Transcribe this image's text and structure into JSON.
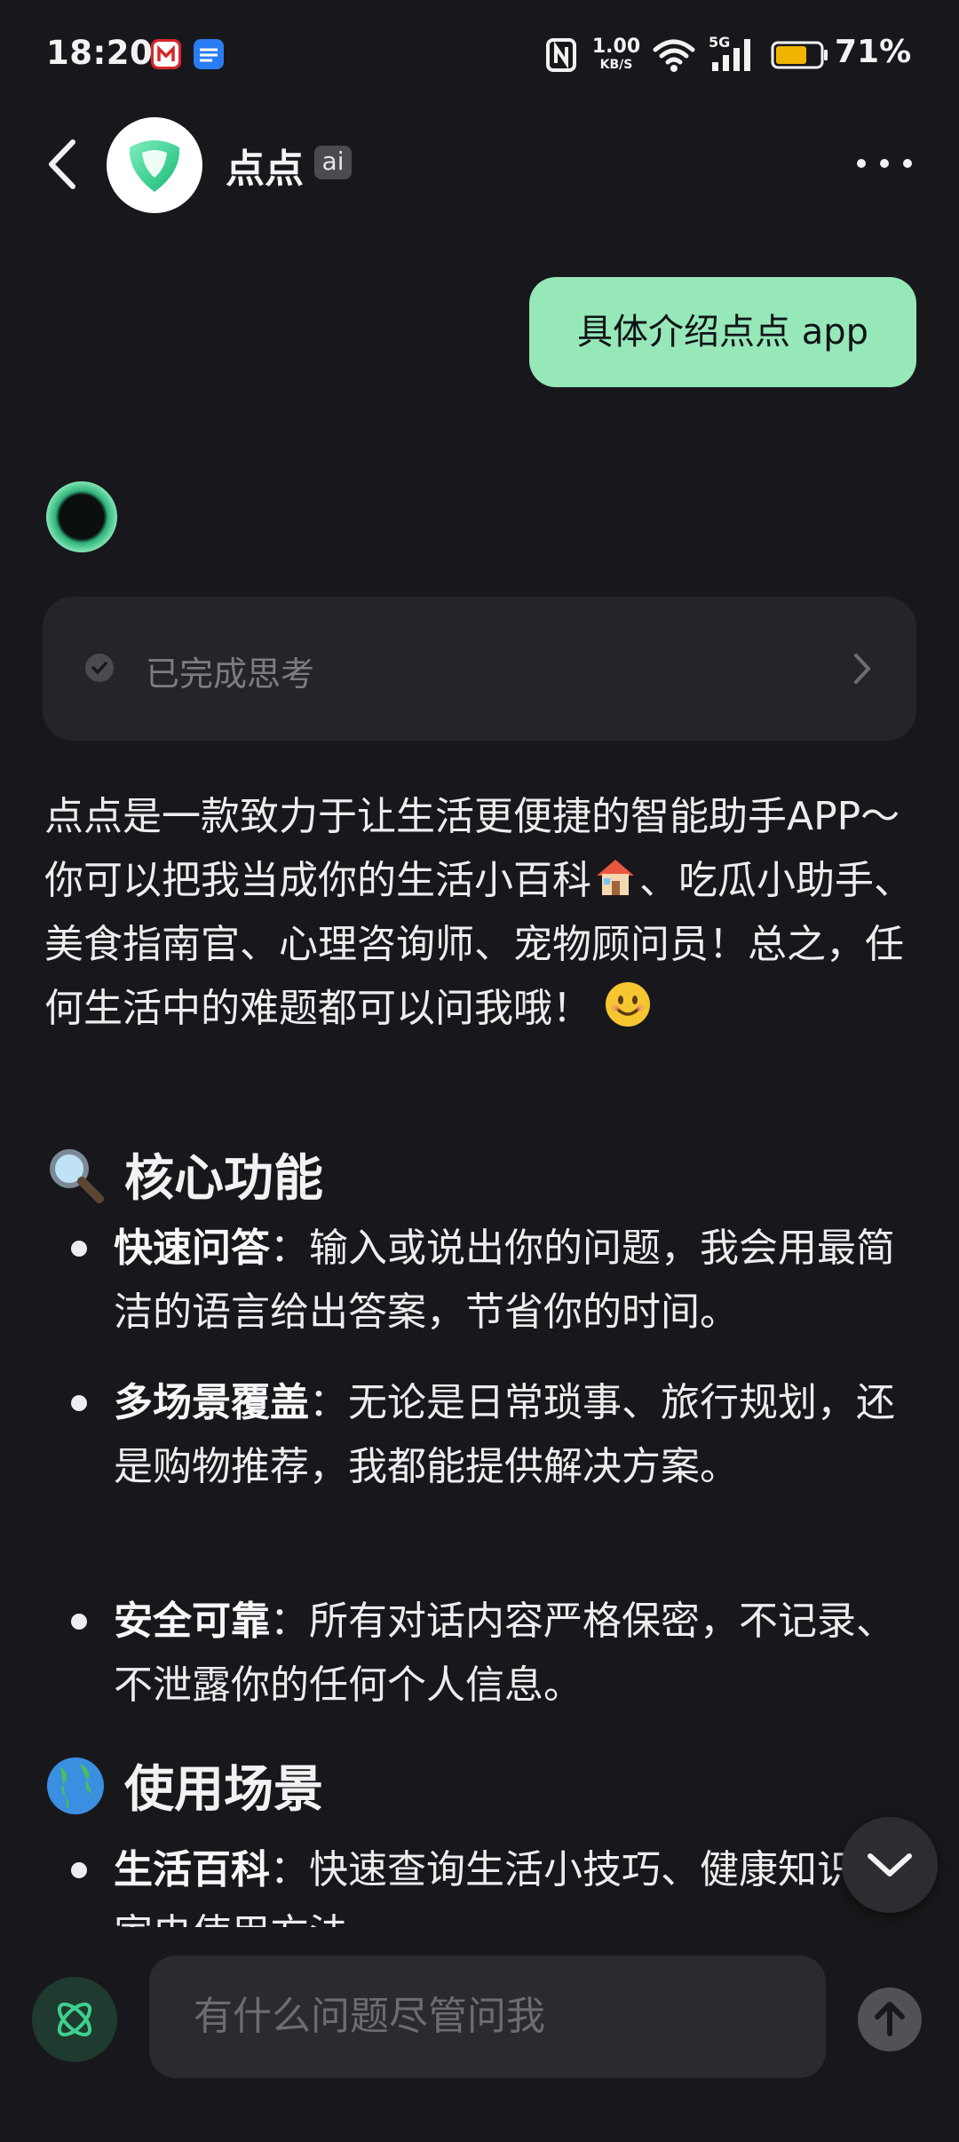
{
  "status_bar": {
    "time": "18:20",
    "net_speed_value": "1.00",
    "net_speed_unit": "KB/S",
    "network_type": "5G",
    "battery_percent": "71%",
    "battery_level": 0.71,
    "colors": {
      "battery_fill": "#f0b400"
    }
  },
  "header": {
    "title": "点点",
    "badge": "ai",
    "back_icon": "chevron-left-icon",
    "more_icon": "more-dots-icon"
  },
  "messages": {
    "user_text": "具体介绍点点 app",
    "thinking_label": "已完成思考",
    "intro_text": "点点是一款致力于让生活更便捷的智能助手APP～ 你可以把我当成你的生活小百科",
    "intro_text_2": "、吃瓜小助手、美食指南官、心理咨询师、宠物顾问员！总之，任何生活中的难题都可以问我哦！",
    "section1_title": "核心功能",
    "section1_items": [
      {
        "term": "快速问答",
        "desc": "：输入或说出你的问题，我会用最简洁的语言给出答案，节省你的时间。"
      },
      {
        "term": "多场景覆盖",
        "desc": "：无论是日常琐事、旅行规划，还是购物推荐，我都能提供解决方案。"
      },
      {
        "term": "安全可靠",
        "desc": "：所有对话内容严格保密，不记录、不泄露你的任何个人信息。"
      }
    ],
    "section2_title": "使用场景",
    "section2_items": [
      {
        "term": "生活百科",
        "desc": "：快速查询生活小技巧、健康知识、家电使用方法。"
      }
    ]
  },
  "composer": {
    "placeholder": "有什么问题尽管问我"
  },
  "colors": {
    "background": "#18181c",
    "user_bubble": "#97e8b9",
    "accent_green": "#3fcf8e"
  }
}
